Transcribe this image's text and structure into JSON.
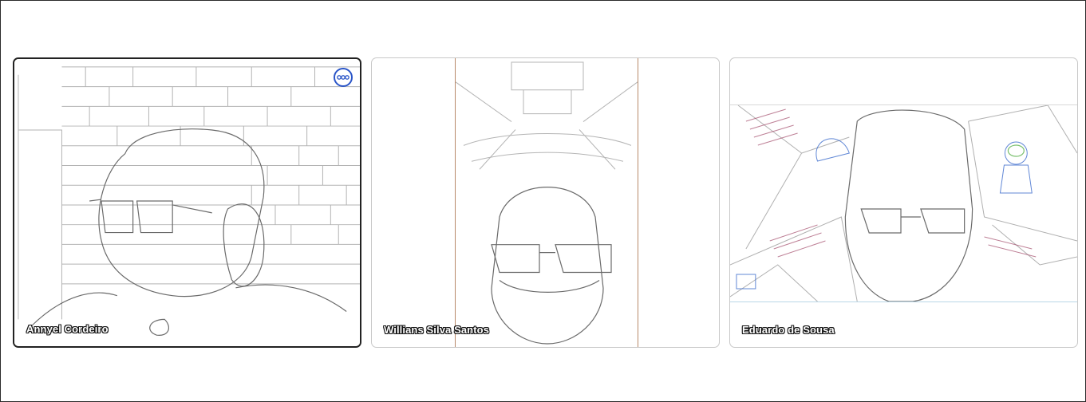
{
  "participants": [
    {
      "name": "Annyel Cordeiro",
      "active": true,
      "more_icon": "more-options-icon"
    },
    {
      "name": "Willians Silva Santos",
      "active": false
    },
    {
      "name": "Eduardo de Sousa",
      "active": false
    }
  ],
  "colors": {
    "active_outline": "#222222",
    "tile_border": "#c8c8c8",
    "more_button": "#2a55c8"
  }
}
